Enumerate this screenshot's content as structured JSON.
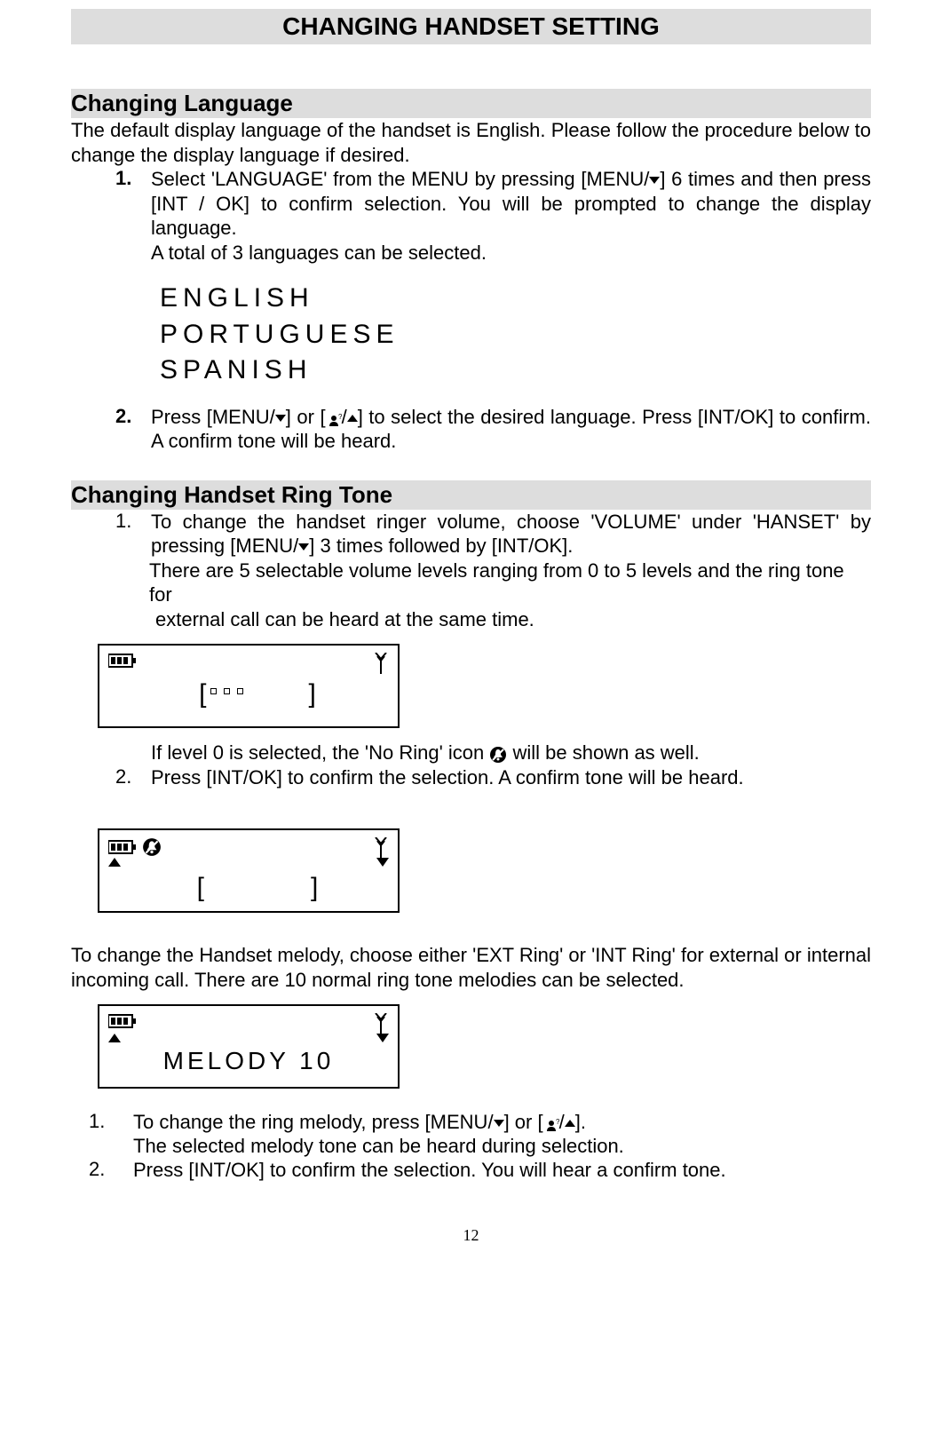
{
  "title": "CHANGING HANDSET SETTING",
  "lang_section": {
    "heading": "Changing Language",
    "intro": "The default display language of the handset is English. Please follow the procedure below to change the display language if desired.",
    "step1_num": "1.",
    "step1_a": "Select 'LANGUAGE' from the MENU by pressing [MENU/",
    "step1_b": "] 6 times and then press [INT / OK] to confirm selection. You will be prompted to change the display language.",
    "step1_cont": " A total of 3 languages can be selected.",
    "lang1": "ENGLISH",
    "lang2": "PORTUGUESE",
    "lang3": "SPANISH",
    "step2_num": "2.",
    "step2_a": "Press [MENU/",
    "step2_b": "] or [",
    "step2_c": "/",
    "step2_d": "] to select the desired language. Press [INT/OK] to confirm. A confirm tone will be heard."
  },
  "ring_section": {
    "heading": "Changing Handset Ring Tone",
    "step1_num": "1.",
    "step1_a": "To change the handset ringer volume, choose 'VOLUME' under 'HANSET' by pressing [MENU/",
    "step1_b": "] 3 times followed by [INT/OK].",
    "step1_cont1": "There are 5 selectable volume levels ranging from 0 to 5 levels and the ring tone for",
    "step1_cont2": " external call can be heard at the same time.",
    "no_ring_a": "If level 0 is selected, the 'No Ring' icon ",
    "no_ring_b": " will be shown as well.",
    "step2_num": "2.",
    "step2": "Press [INT/OK] to confirm the selection. A confirm tone will be heard.",
    "melody_intro": "To change the Handset melody, choose either 'EXT Ring' or 'INT Ring' for external or internal incoming call.  There are 10 normal ring tone melodies can be selected.",
    "melody_display": "MELODY  10",
    "mstep1_num": "1.",
    "mstep1_a": "To change the ring melody, press [MENU/",
    "mstep1_b": "] or [",
    "mstep1_c": "/",
    "mstep1_d": "].",
    "mstep1_cont": "The selected melody tone can be heard during selection.",
    "mstep2_num": "2.",
    "mstep2": "Press [INT/OK] to confirm the selection. You will hear a confirm tone."
  },
  "page_number": "12"
}
